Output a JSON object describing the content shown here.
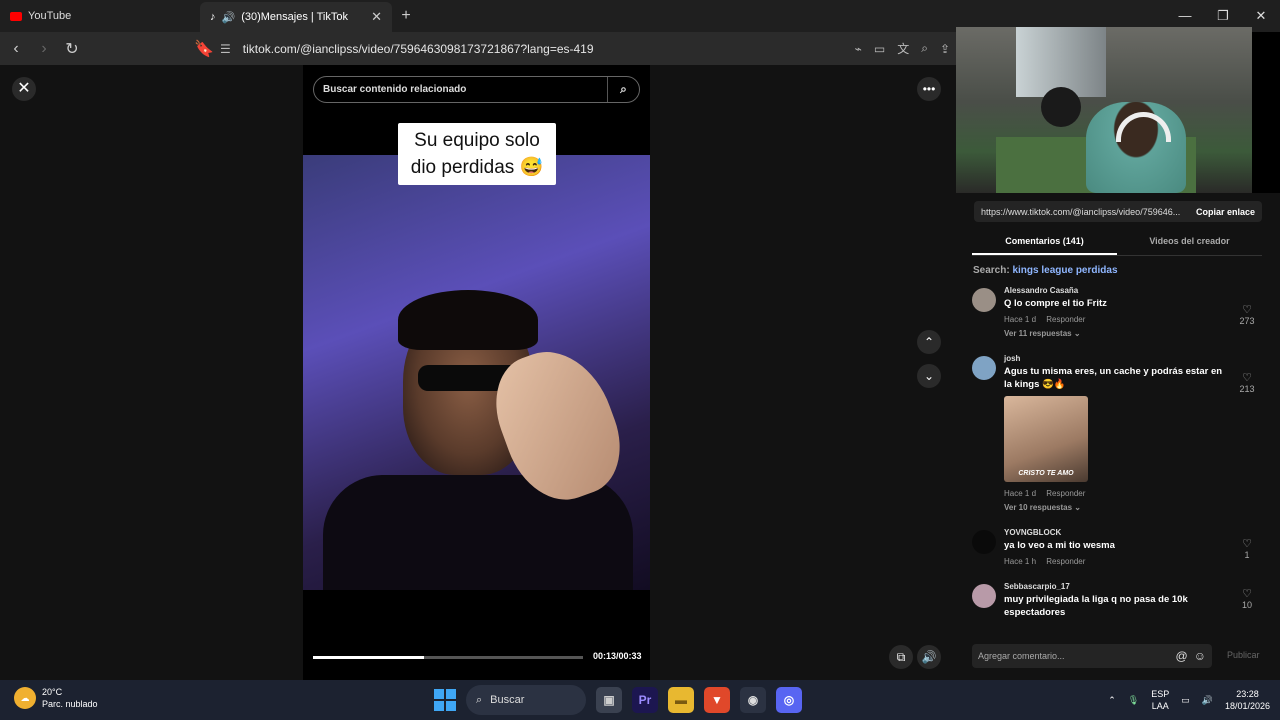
{
  "browser": {
    "tabs": [
      {
        "label": "YouTube",
        "icon": "youtube-icon"
      },
      {
        "label": "(30)Mensajes | TikTok",
        "icon": "tiktok-icon"
      }
    ],
    "url": "tiktok.com/@ianclipss/video/7596463098173721867?lang=es-419"
  },
  "player": {
    "search_placeholder": "Buscar contenido relacionado",
    "caption_line1": "Su equipo solo",
    "caption_line2": "dio perdidas 😅",
    "time": "00:13/00:33",
    "progress": 0.41
  },
  "sidebar": {
    "link": "https://www.tiktok.com/@ianclipss/video/759646...",
    "copy_label": "Copiar enlace",
    "tab_comments": "Comentarios (141)",
    "tab_videos": "Videos del creador",
    "search_prefix": "Search:",
    "search_keyword": "kings league perdidas",
    "comments": [
      {
        "user": "Alessandro Casaña",
        "text": "Q lo compre el tio Fritz",
        "time": "Hace 1 d",
        "reply": "Responder",
        "replies": "Ver 11 respuestas ⌄",
        "likes": "273"
      },
      {
        "user": "josh",
        "text": "Agus tu misma eres, un cache y podrás estar en la kings 😎🔥",
        "gif_text": "CRISTO TE AMO",
        "time": "Hace 1 d",
        "reply": "Responder",
        "replies": "Ver 10 respuestas ⌄",
        "likes": "213"
      },
      {
        "user": "YOVNGBLOCK",
        "text": "ya lo veo a mi tio wesma",
        "time": "Hace 1 h",
        "reply": "Responder",
        "likes": "1"
      },
      {
        "user": "Sebbascarpio_17",
        "text": "muy privilegiada la liga q no pasa de 10k espectadores",
        "likes": "10"
      }
    ],
    "add_comment": "Agregar comentario...",
    "publish": "Publicar"
  },
  "taskbar": {
    "temp": "20°C",
    "weather": "Parc. nublado",
    "search": "Buscar",
    "lang1": "ESP",
    "lang2": "LAA",
    "clock_time": "23:28",
    "clock_date": "18/01/2026"
  }
}
